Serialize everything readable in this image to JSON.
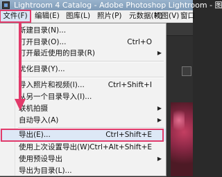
{
  "window": {
    "title": "Lightroom 4 Catalog - Adobe Photoshop Lightroom - 图库",
    "icon": "lightroom-app-icon"
  },
  "menubar": {
    "file": "文件(F)",
    "edit": "编辑(E)",
    "library": "图库(L)",
    "photo": "照片(P)",
    "metadata": "元数据(M)",
    "view": "视图(V)",
    "window": "窗口"
  },
  "file_menu": {
    "new_catalog": "新建目录(N)...",
    "open_catalog": {
      "label": "打开目录(O)...",
      "shortcut": "Ctrl+O"
    },
    "open_recent": "打开最近使用的目录(R)",
    "optimize_catalog": "优化目录(Y)...",
    "import_photos": {
      "label": "导入照片和视频(I)...",
      "shortcut": "Ctrl+Shift+I"
    },
    "import_from_catalog": "从另一个目录导入(I)...",
    "tethered_capture": "联机拍摄",
    "auto_import": "自动导入(A)",
    "export": {
      "label": "导出(E)...",
      "shortcut": "Ctrl+Shift+E"
    },
    "export_previous": {
      "label": "使用上次设置导出(W)",
      "shortcut": "Ctrl+Alt+Shift+E"
    },
    "export_preset": "使用预设导出",
    "export_as_catalog": "导出为目录(L)..."
  },
  "colors": {
    "highlight": "#e23a6a",
    "menu_bg": "#f2f2f2",
    "titlebar": "#8aa6c1"
  }
}
